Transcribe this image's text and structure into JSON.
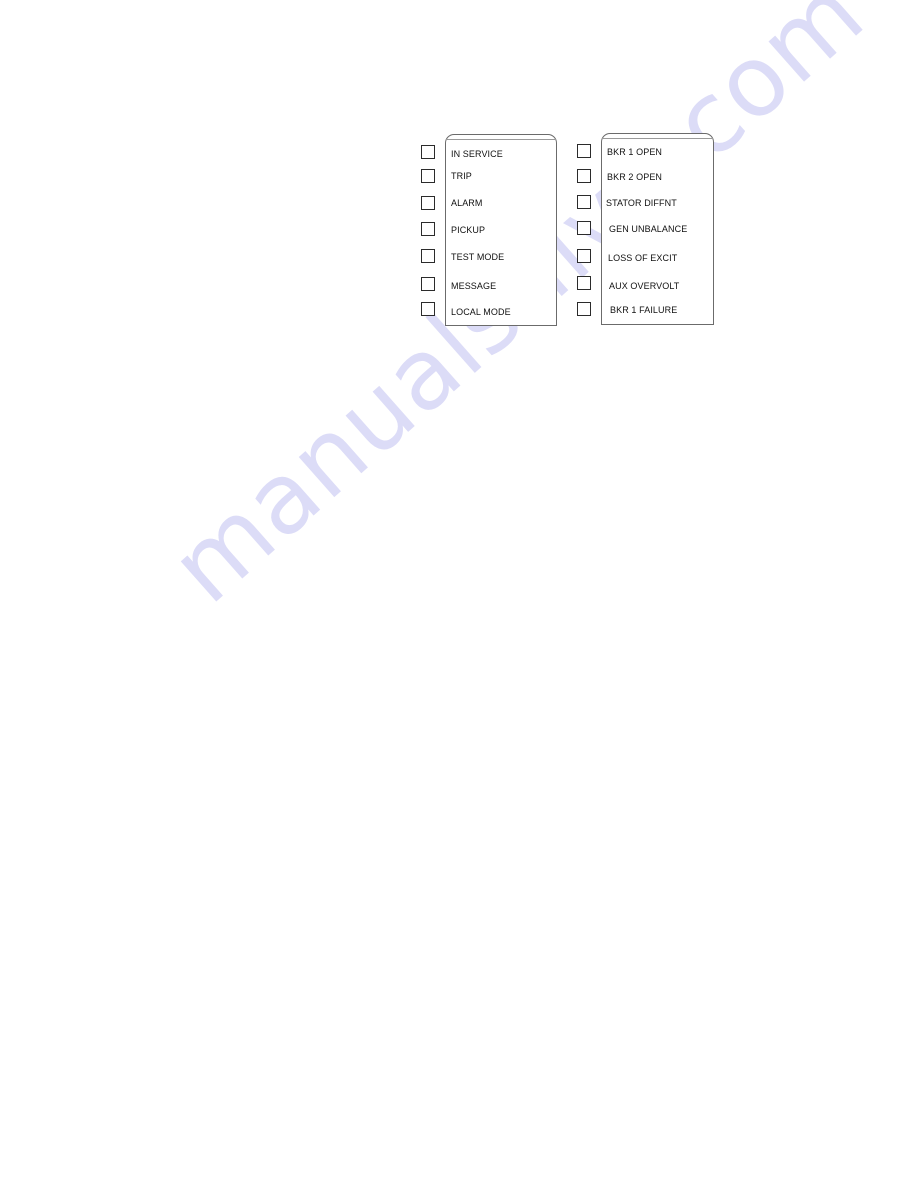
{
  "watermark": "manualshive.com",
  "panels": {
    "left": {
      "items": [
        {
          "label": "IN SERVICE"
        },
        {
          "label": "TRIP"
        },
        {
          "label": "ALARM"
        },
        {
          "label": "PICKUP"
        },
        {
          "label": "TEST MODE"
        },
        {
          "label": "MESSAGE"
        },
        {
          "label": "LOCAL MODE"
        }
      ]
    },
    "right": {
      "items": [
        {
          "label": "BKR 1 OPEN"
        },
        {
          "label": "BKR 2 OPEN"
        },
        {
          "label": "STATOR DIFFNT"
        },
        {
          "label": "GEN UNBALANCE"
        },
        {
          "label": "LOSS OF EXCIT"
        },
        {
          "label": "AUX OVERVOLT"
        },
        {
          "label": "BKR 1 FAILURE"
        }
      ]
    }
  }
}
